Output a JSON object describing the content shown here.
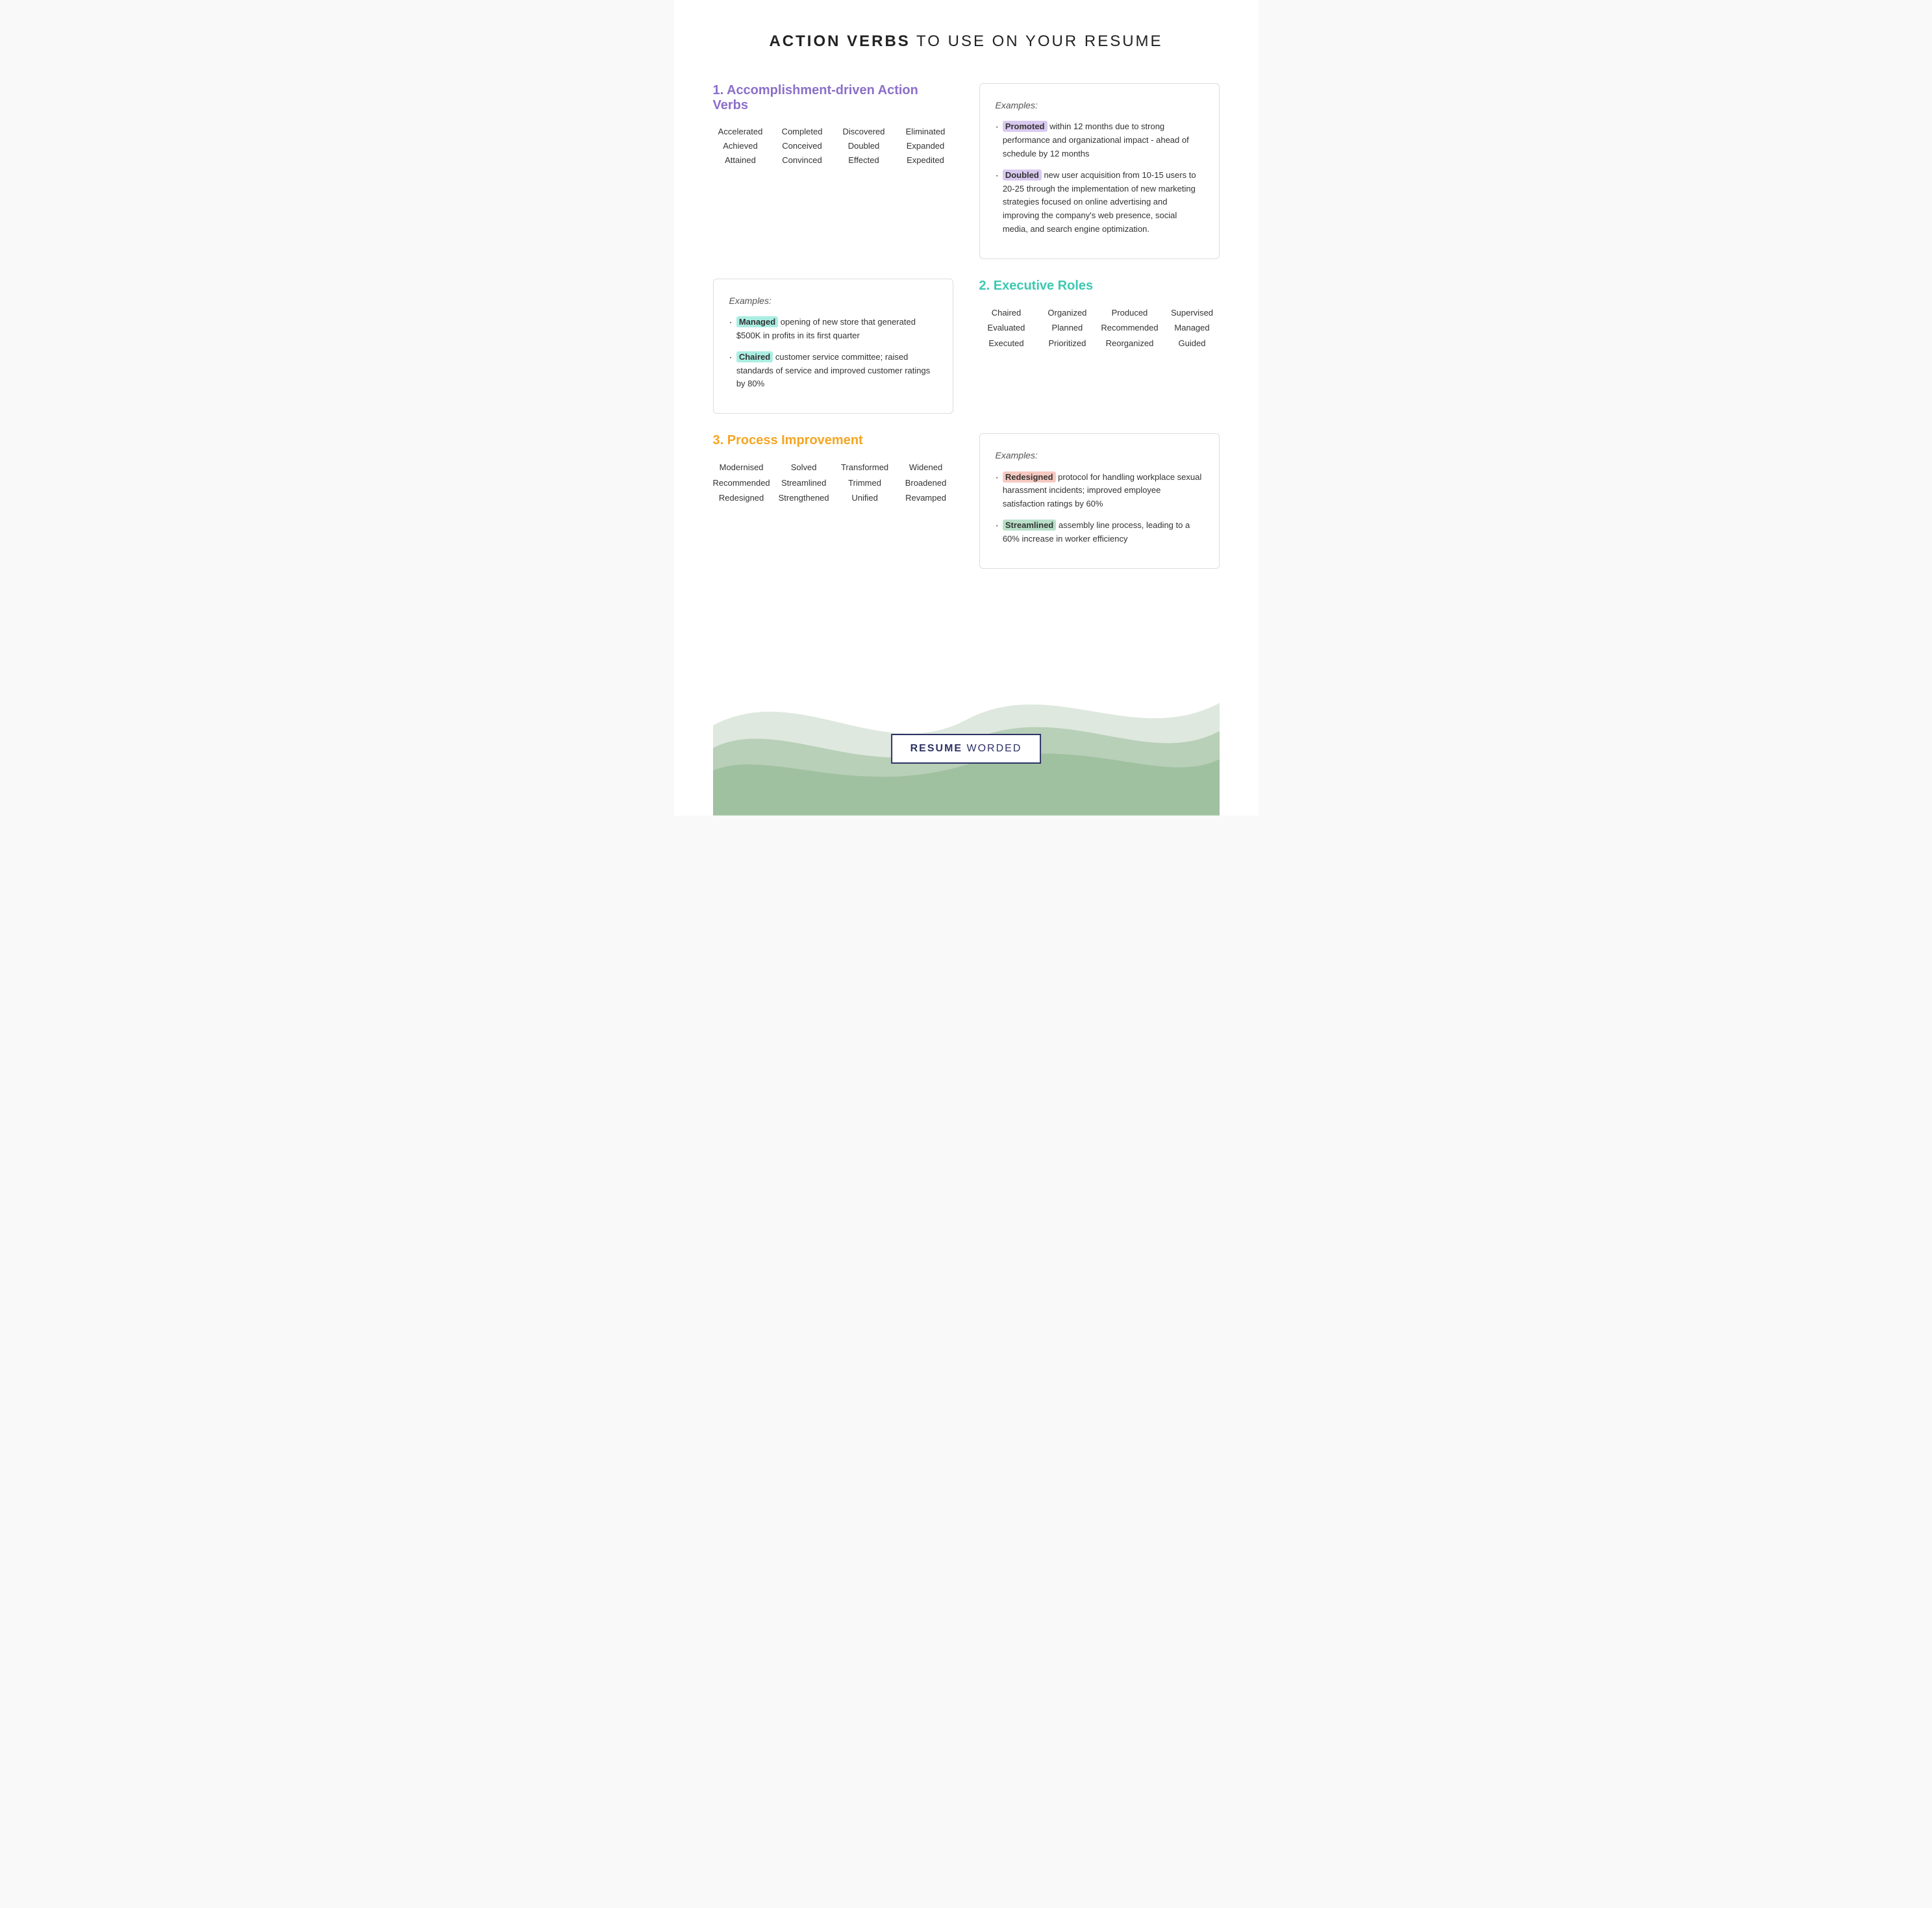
{
  "page": {
    "title_bold": "ACTION VERBS",
    "title_rest": " TO USE ON YOUR RESUME"
  },
  "section1": {
    "title": "1. Accomplishment-driven Action Verbs",
    "words": [
      [
        "Accelerated",
        "Achieved",
        "Attained"
      ],
      [
        "Completed",
        "Conceived",
        "Convinced"
      ],
      [
        "Discovered",
        "Doubled",
        "Effected"
      ],
      [
        "Eliminated",
        "Expanded",
        "Expedited"
      ]
    ],
    "examples_label": "Examples:",
    "examples": [
      {
        "highlight": "Promoted",
        "highlight_class": "purple",
        "text": " within 12 months due to strong performance and organizational impact - ahead of schedule by 12 months"
      },
      {
        "highlight": "Doubled",
        "highlight_class": "purple",
        "text": " new user acquisition from 10-15 users to 20-25 through the implementation of new marketing strategies focused on online advertising and improving the company's web presence, social media, and search engine optimization."
      }
    ]
  },
  "section2": {
    "title": "2. Executive Roles",
    "words": [
      [
        "Chaired",
        "Evaluated",
        "Executed"
      ],
      [
        "Organized",
        "Planned",
        "Prioritized"
      ],
      [
        "Produced",
        "Recommended",
        "Reorganized"
      ],
      [
        "Supervised",
        "Managed",
        "Guided"
      ]
    ],
    "examples_label": "Examples:",
    "examples": [
      {
        "highlight": "Managed",
        "highlight_class": "teal",
        "text": " opening of new store that generated $500K in profits in its first quarter"
      },
      {
        "highlight": "Chaired",
        "highlight_class": "teal",
        "text": " customer service committee; raised standards of service and improved customer ratings by 80%"
      }
    ]
  },
  "section3": {
    "title": "3. Process Improvement",
    "words": [
      [
        "Modernised",
        "Recommended",
        "Redesigned"
      ],
      [
        "Solved",
        "Streamlined",
        "Strengthened"
      ],
      [
        "Transformed",
        "Trimmed",
        "Unified"
      ],
      [
        "Widened",
        "Broadened",
        "Revamped"
      ]
    ],
    "examples_label": "Examples:",
    "examples": [
      {
        "highlight": "Redesigned",
        "highlight_class": "pink",
        "text": " protocol for handling workplace sexual harassment incidents; improved employee satisfaction ratings by 60%"
      },
      {
        "highlight": "Streamlined",
        "highlight_class": "green",
        "text": " assembly line process, leading to a 60% increase in worker efficiency"
      }
    ]
  },
  "footer": {
    "logo_bold": "RESUME",
    "logo_rest": " WORDED"
  }
}
